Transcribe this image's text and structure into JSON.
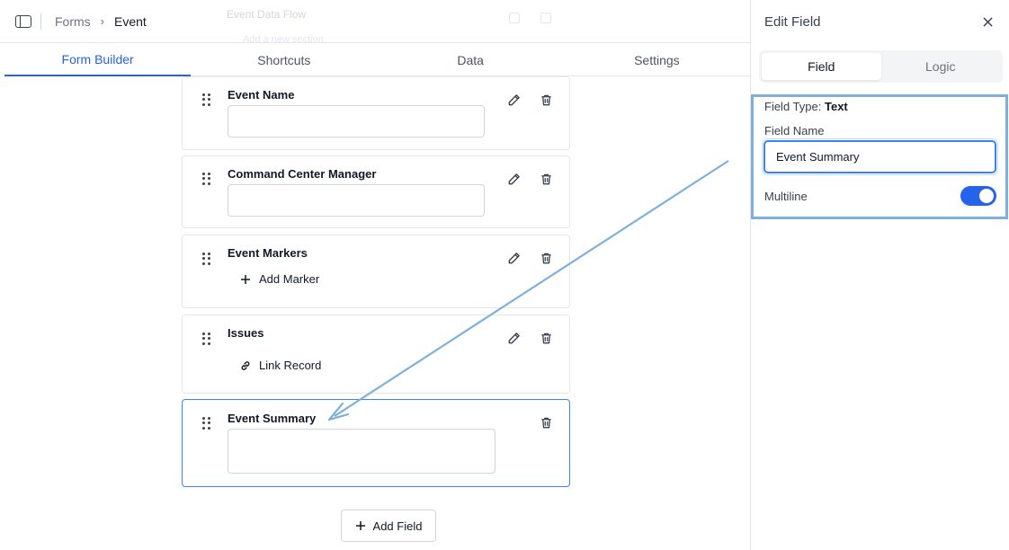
{
  "breadcrumb": {
    "root": "Forms",
    "current": "Event"
  },
  "ghost": {
    "title": "Event Data Flow",
    "subtitle": "Add a new section"
  },
  "tabs": [
    {
      "label": "Form Builder",
      "active": true
    },
    {
      "label": "Shortcuts",
      "active": false
    },
    {
      "label": "Data",
      "active": false
    },
    {
      "label": "Settings",
      "active": false
    }
  ],
  "fields": [
    {
      "label": "Event Name",
      "type": "text"
    },
    {
      "label": "Command Center Manager",
      "type": "text"
    },
    {
      "label": "Event Markers",
      "type": "marker",
      "action": "Add Marker"
    },
    {
      "label": "Issues",
      "type": "link",
      "action": "Link Record"
    },
    {
      "label": "Event Summary",
      "type": "text",
      "selected": true
    }
  ],
  "add_field_label": "Add Field",
  "panel": {
    "title": "Edit Field",
    "tabs": {
      "field": "Field",
      "logic": "Logic"
    },
    "field_type_label": "Field Type:",
    "field_type_value": "Text",
    "field_name_label": "Field Name",
    "field_name_value": "Event Summary",
    "multiline_label": "Multiline",
    "multiline_on": true
  },
  "colors": {
    "accent": "#2563eb",
    "annotation": "#7fb0dc"
  }
}
